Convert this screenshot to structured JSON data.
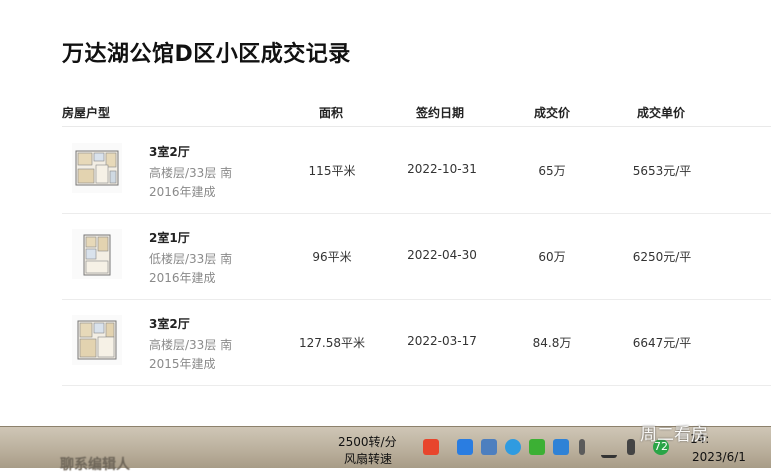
{
  "page": {
    "title": "万达湖公馆D区小区成交记录"
  },
  "table": {
    "headers": {
      "type": "房屋户型",
      "area": "面积",
      "date": "签约日期",
      "price": "成交价",
      "unit_price": "成交单价"
    },
    "rows": [
      {
        "layout": "3室2厅",
        "floor": "高楼层/33层 南",
        "built": "2016年建成",
        "area": "115平米",
        "date": "2022-10-31",
        "price": "65万",
        "unit_price": "5653元/平"
      },
      {
        "layout": "2室1厅",
        "floor": "低楼层/33层 南",
        "built": "2016年建成",
        "area": "96平米",
        "date": "2022-04-30",
        "price": "60万",
        "unit_price": "6250元/平"
      },
      {
        "layout": "3室2厅",
        "floor": "高楼层/33层 南",
        "built": "2015年建成",
        "area": "127.58平米",
        "date": "2022-03-17",
        "price": "84.8万",
        "unit_price": "6647元/平"
      }
    ]
  },
  "taskbar": {
    "fan_speed": "2500转/分",
    "fan_label": "风扇转速",
    "badge": "72",
    "clock": "14:",
    "date": "2023/6/1",
    "watermark": "周二看房",
    "blurred_text": "聊系编辑人"
  }
}
